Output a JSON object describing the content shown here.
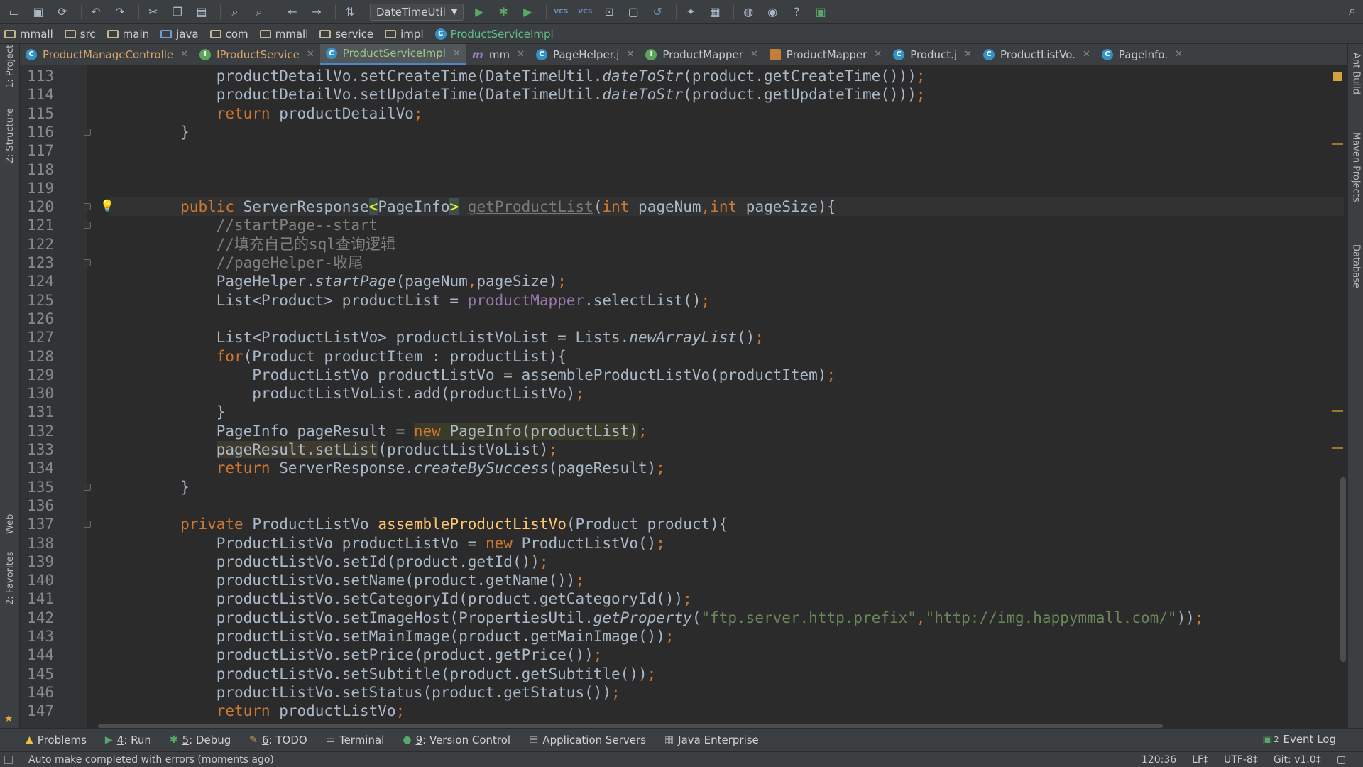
{
  "toolbar": {
    "run_config": "DateTimeUtil",
    "vcs_label": "VCS"
  },
  "breadcrumb": [
    "mmall",
    "src",
    "main",
    "java",
    "com",
    "mmall",
    "service",
    "impl",
    "ProductServiceImpl"
  ],
  "tabs": [
    {
      "label": "ProductManageControlle",
      "icon": "class-icon",
      "kind": "c",
      "active": false,
      "color": "orange"
    },
    {
      "label": "IProductService",
      "icon": "interface-icon",
      "kind": "i",
      "active": false,
      "color": "orange"
    },
    {
      "label": "ProductServiceImpl",
      "icon": "class-icon",
      "kind": "c",
      "active": true,
      "color": "green"
    },
    {
      "label": "mm",
      "icon": "maven-icon",
      "kind": "m",
      "active": false,
      "color": "normal"
    },
    {
      "label": "PageHelper.j",
      "icon": "class-icon",
      "kind": "c",
      "active": false,
      "color": "normal"
    },
    {
      "label": "ProductMapper",
      "icon": "interface-icon",
      "kind": "i",
      "active": false,
      "color": "normal"
    },
    {
      "label": "ProductMapper",
      "icon": "xml-icon",
      "kind": "x",
      "active": false,
      "color": "normal"
    },
    {
      "label": "Product.j",
      "icon": "class-icon",
      "kind": "c",
      "active": false,
      "color": "normal"
    },
    {
      "label": "ProductListVo.",
      "icon": "class-icon",
      "kind": "c",
      "active": false,
      "color": "normal"
    },
    {
      "label": "PageInfo.",
      "icon": "class-icon",
      "kind": "c",
      "active": false,
      "color": "normal"
    }
  ],
  "left_tools": [
    "1: Project",
    "Z: Structure",
    "Web",
    "2: Favorites"
  ],
  "right_tools": [
    "Ant Build",
    "Maven Projects",
    "Database"
  ],
  "code": {
    "current_line": 120,
    "lines": [
      {
        "n": "113",
        "tokens": [
          [
            "            productDetailVo.setCreateTime(DateTimeUtil.",
            ""
          ],
          [
            "dateToStr",
            "it"
          ],
          [
            "(product.getCreateTime()))",
            ""
          ],
          [
            ";",
            "kw"
          ]
        ]
      },
      {
        "n": "114",
        "tokens": [
          [
            "            productDetailVo.setUpdateTime(DateTimeUtil.",
            ""
          ],
          [
            "dateToStr",
            "it"
          ],
          [
            "(product.getUpdateTime()))",
            ""
          ],
          [
            ";",
            "kw"
          ]
        ]
      },
      {
        "n": "115",
        "tokens": [
          [
            "            ",
            ""
          ],
          [
            "return",
            "kw"
          ],
          [
            " productDetailVo",
            ""
          ],
          [
            ";",
            "kw"
          ]
        ]
      },
      {
        "n": "116",
        "tokens": [
          [
            "        }",
            ""
          ]
        ]
      },
      {
        "n": "117",
        "tokens": []
      },
      {
        "n": "118",
        "tokens": []
      },
      {
        "n": "119",
        "tokens": []
      },
      {
        "n": "120",
        "tokens": [
          [
            "        ",
            ""
          ],
          [
            "public",
            "kw"
          ],
          [
            " ServerResponse",
            ""
          ],
          [
            "<",
            "brace-hl"
          ],
          [
            "PageInfo",
            ""
          ],
          [
            ">",
            "brace-hl"
          ],
          [
            " ",
            ""
          ],
          [
            "getProductList",
            "unused"
          ],
          [
            "(",
            ""
          ],
          [
            "int",
            "kw"
          ],
          [
            " pageNum",
            ""
          ],
          [
            ",",
            "kw"
          ],
          [
            "int",
            "kw"
          ],
          [
            " pageSize){",
            ""
          ]
        ]
      },
      {
        "n": "121",
        "tokens": [
          [
            "            ",
            ""
          ],
          [
            "//startPage--start",
            "cm"
          ]
        ]
      },
      {
        "n": "122",
        "tokens": [
          [
            "            ",
            ""
          ],
          [
            "//填充自己的sql查询逻辑",
            "cm"
          ]
        ]
      },
      {
        "n": "123",
        "tokens": [
          [
            "            ",
            ""
          ],
          [
            "//pageHelper-收尾",
            "cm"
          ]
        ]
      },
      {
        "n": "124",
        "tokens": [
          [
            "            PageHelper.",
            ""
          ],
          [
            "startPage",
            "it"
          ],
          [
            "(pageNum",
            ""
          ],
          [
            ",",
            "kw"
          ],
          [
            "pageSize)",
            ""
          ],
          [
            ";",
            "kw"
          ]
        ]
      },
      {
        "n": "125",
        "tokens": [
          [
            "            List<Product> productList = ",
            ""
          ],
          [
            "productMapper",
            "fld"
          ],
          [
            ".selectList()",
            ""
          ],
          [
            ";",
            "kw"
          ]
        ]
      },
      {
        "n": "126",
        "tokens": []
      },
      {
        "n": "127",
        "tokens": [
          [
            "            List<ProductListVo> productListVoList = Lists.",
            ""
          ],
          [
            "newArrayList",
            "it"
          ],
          [
            "()",
            ""
          ],
          [
            ";",
            "kw"
          ]
        ]
      },
      {
        "n": "128",
        "tokens": [
          [
            "            ",
            ""
          ],
          [
            "for",
            "kw"
          ],
          [
            "(Product productItem : productList){",
            ""
          ]
        ]
      },
      {
        "n": "129",
        "tokens": [
          [
            "                ProductListVo productListVo = assembleProductListVo(productItem)",
            ""
          ],
          [
            ";",
            "kw"
          ]
        ]
      },
      {
        "n": "130",
        "tokens": [
          [
            "                productListVoList.add(productListVo)",
            ""
          ],
          [
            ";",
            "kw"
          ]
        ]
      },
      {
        "n": "131",
        "tokens": [
          [
            "            }",
            ""
          ]
        ]
      },
      {
        "n": "132",
        "tokens": [
          [
            "            PageInfo pageResult = ",
            ""
          ],
          [
            "new",
            "kw hl"
          ],
          [
            " PageInfo(productList)",
            "hl"
          ],
          [
            ";",
            "kw"
          ]
        ]
      },
      {
        "n": "133",
        "tokens": [
          [
            "            ",
            ""
          ],
          [
            "pageResult.setList",
            "hl2"
          ],
          [
            "(productListVoList)",
            ""
          ],
          [
            ";",
            "kw"
          ]
        ]
      },
      {
        "n": "134",
        "tokens": [
          [
            "            ",
            ""
          ],
          [
            "return",
            "kw"
          ],
          [
            " ServerResponse.",
            ""
          ],
          [
            "createBySuccess",
            "it"
          ],
          [
            "(pageResult)",
            ""
          ],
          [
            ";",
            "kw"
          ]
        ]
      },
      {
        "n": "135",
        "tokens": [
          [
            "        }",
            ""
          ]
        ]
      },
      {
        "n": "136",
        "tokens": []
      },
      {
        "n": "137",
        "tokens": [
          [
            "        ",
            ""
          ],
          [
            "private",
            "kw"
          ],
          [
            " ProductListVo ",
            ""
          ],
          [
            "assembleProductListVo",
            "fn"
          ],
          [
            "(Product product){",
            ""
          ]
        ]
      },
      {
        "n": "138",
        "tokens": [
          [
            "            ProductListVo productListVo = ",
            ""
          ],
          [
            "new",
            "kw"
          ],
          [
            " ProductListVo()",
            ""
          ],
          [
            ";",
            "kw"
          ]
        ]
      },
      {
        "n": "139",
        "tokens": [
          [
            "            productListVo.setId(product.getId())",
            ""
          ],
          [
            ";",
            "kw"
          ]
        ]
      },
      {
        "n": "140",
        "tokens": [
          [
            "            productListVo.setName(product.getName())",
            ""
          ],
          [
            ";",
            "kw"
          ]
        ]
      },
      {
        "n": "141",
        "tokens": [
          [
            "            productListVo.setCategoryId(product.getCategoryId())",
            ""
          ],
          [
            ";",
            "kw"
          ]
        ]
      },
      {
        "n": "142",
        "tokens": [
          [
            "            productListVo.setImageHost(PropertiesUtil.",
            ""
          ],
          [
            "getProperty",
            "it"
          ],
          [
            "(",
            ""
          ],
          [
            "\"ftp.server.http.prefix\"",
            "str"
          ],
          [
            ",",
            "kw"
          ],
          [
            "\"http://img.happymmall.com/\"",
            "str"
          ],
          [
            "))",
            ""
          ],
          [
            ";",
            "kw"
          ]
        ]
      },
      {
        "n": "143",
        "tokens": [
          [
            "            productListVo.setMainImage(product.getMainImage())",
            ""
          ],
          [
            ";",
            "kw"
          ]
        ]
      },
      {
        "n": "144",
        "tokens": [
          [
            "            productListVo.setPrice(product.getPrice())",
            ""
          ],
          [
            ";",
            "kw"
          ]
        ]
      },
      {
        "n": "145",
        "tokens": [
          [
            "            productListVo.setSubtitle(product.getSubtitle())",
            ""
          ],
          [
            ";",
            "kw"
          ]
        ]
      },
      {
        "n": "146",
        "tokens": [
          [
            "            productListVo.setStatus(product.getStatus())",
            ""
          ],
          [
            ";",
            "kw"
          ]
        ]
      },
      {
        "n": "147",
        "tokens": [
          [
            "            ",
            ""
          ],
          [
            "return",
            "kw"
          ],
          [
            " productListVo",
            ""
          ],
          [
            ";",
            "kw"
          ]
        ]
      }
    ]
  },
  "toolwindows": [
    {
      "icon": "warning-icon",
      "glyph": "▲",
      "num": "",
      "label": "Problems",
      "color": "#e8c43a"
    },
    {
      "icon": "run-icon",
      "glyph": "▶",
      "num": "4",
      "label": ": Run",
      "color": "#59a869"
    },
    {
      "icon": "debug-icon",
      "glyph": "✱",
      "num": "5",
      "label": ": Debug",
      "color": "#59a869"
    },
    {
      "icon": "todo-icon",
      "glyph": "✎",
      "num": "6",
      "label": ": TODO",
      "color": "#c8a05a"
    },
    {
      "icon": "terminal-icon",
      "glyph": "▭",
      "num": "",
      "label": "Terminal",
      "color": "#d0d0d0"
    },
    {
      "icon": "vcs-icon",
      "glyph": "●",
      "num": "9",
      "label": ": Version Control",
      "color": "#59a869"
    },
    {
      "icon": "server-icon",
      "glyph": "▤",
      "num": "",
      "label": "Application Servers",
      "color": "#a0a0a0"
    },
    {
      "icon": "enterprise-icon",
      "glyph": "▦",
      "num": "",
      "label": "Java Enterprise",
      "color": "#a0a0a0"
    }
  ],
  "event_log": {
    "count": "2",
    "label": "Event Log"
  },
  "status": {
    "message": "Auto make completed with errors (moments ago)",
    "position": "120:36",
    "line_sep": "LF‡",
    "encoding": "UTF-8‡",
    "git": "Git: v1.0‡"
  },
  "colors": {
    "keyword": "#cc7832",
    "method": "#ffc66d",
    "field": "#9876aa",
    "comment": "#808080",
    "string": "#6a8759",
    "text": "#a9b7c6"
  }
}
